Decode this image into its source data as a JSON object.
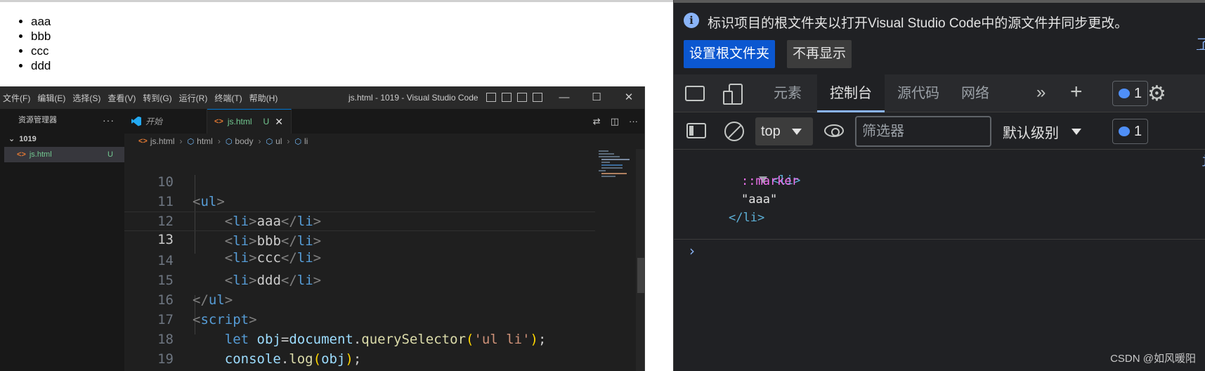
{
  "rendered_page": {
    "list_items": [
      "aaa",
      "bbb",
      "ccc",
      "ddd"
    ]
  },
  "vscode": {
    "menu": [
      "文件(F)",
      "编辑(E)",
      "选择(S)",
      "查看(V)",
      "转到(G)",
      "运行(R)",
      "终端(T)",
      "帮助(H)"
    ],
    "title": "js.html - 1019 - Visual Studio Code",
    "window_controls": {
      "minimize": "—",
      "maximize": "☐",
      "close": "✕"
    },
    "sidebar": {
      "title": "资源管理器",
      "more": "···",
      "folder": "1019",
      "file": {
        "name": "js.html",
        "status": "U"
      }
    },
    "tabs": [
      {
        "label": "开始"
      },
      {
        "label": "js.html",
        "status": "U",
        "close": "✕"
      }
    ],
    "breadcrumb": [
      "js.html",
      "html",
      "body",
      "ul",
      "li"
    ],
    "editor": {
      "current_line": 13,
      "line_numbers": [
        "10",
        "11",
        "12",
        "13",
        "14",
        "15",
        "16",
        "17",
        "18",
        "19"
      ]
    }
  },
  "devtools": {
    "info_bar": {
      "icon": "i",
      "message": "标识项目的根文件夹以打开Visual Studio Code中的源文件并同步更改。",
      "primary_button": "设置根文件夹",
      "secondary_button": "不再显示",
      "link_text": "了"
    },
    "tabs": [
      "元素",
      "控制台",
      "源代码",
      "网络"
    ],
    "active_tab": "控制台",
    "more_tabs": "»",
    "add_tab": "+",
    "message_count": "1",
    "settings_icon": "⚙",
    "console_toolbar": {
      "context": "top",
      "filter_placeholder": "筛选器",
      "level": "默认级别",
      "message_count": "1"
    },
    "console": {
      "open_tag": "<li>",
      "marker": "::marker",
      "text": "\"aaa\"",
      "close_tag": "</li>",
      "source_link": "j",
      "prompt": "›"
    }
  },
  "watermark": "CSDN @如风暖阳"
}
